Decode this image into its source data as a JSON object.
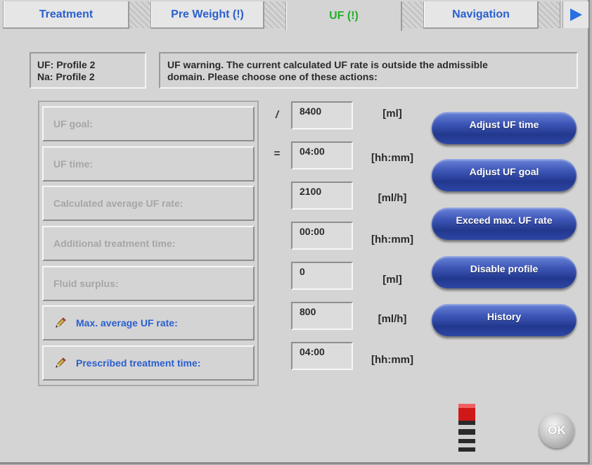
{
  "tabs": [
    {
      "label": "Treatment",
      "active": false
    },
    {
      "label": "Pre Weight (!)",
      "active": false
    },
    {
      "label": "UF (!)",
      "active": true
    },
    {
      "label": "Navigation",
      "active": false
    }
  ],
  "tab_next_icon": "play-arrow-right",
  "profile_info": {
    "uf": "UF: Profile 2",
    "na": "Na: Profile 2"
  },
  "warning": {
    "line1": "UF warning. The current calculated UF rate is outside the admissible",
    "line2": "domain. Please choose one of these actions:"
  },
  "params": [
    {
      "label": "UF goal:",
      "operator": "/",
      "value": "8400",
      "unit": "[ml]",
      "editable": false
    },
    {
      "label": "UF time:",
      "operator": "=",
      "value": "04:00",
      "unit": "[hh:mm]",
      "editable": false
    },
    {
      "label": "Calculated average UF rate:",
      "operator": "",
      "value": "2100",
      "unit": "[ml/h]",
      "editable": false
    },
    {
      "label": "Additional treatment time:",
      "operator": "",
      "value": "00:00",
      "unit": "[hh:mm]",
      "editable": false
    },
    {
      "label": "Fluid surplus:",
      "operator": "",
      "value": "0",
      "unit": "[ml]",
      "editable": false
    },
    {
      "label": "Max. average UF rate:",
      "operator": "",
      "value": "800",
      "unit": "[ml/h]",
      "editable": true,
      "icon": "pencil-icon"
    },
    {
      "label": "Prescribed treatment time:",
      "operator": "",
      "value": "04:00",
      "unit": "[hh:mm]",
      "editable": true,
      "icon": "pencil-icon"
    }
  ],
  "actions": [
    {
      "label": "Adjust UF time"
    },
    {
      "label": "Adjust UF goal"
    },
    {
      "label": "Exceed max. UF rate"
    },
    {
      "label": "Disable profile"
    },
    {
      "label": "History"
    }
  ],
  "ok_button": {
    "label": "OK"
  },
  "colors": {
    "tab_text": "#2a5fcf",
    "tab_active_text": "#23b02a",
    "background": "#d4d4d4",
    "button_blue": "#2d46a5",
    "disabled_text": "#a6a6a6",
    "status_red": "#d01818"
  }
}
